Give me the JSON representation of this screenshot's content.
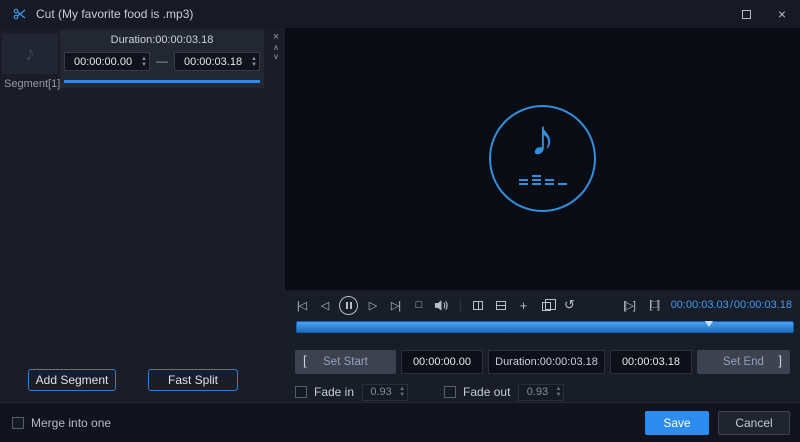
{
  "colors": {
    "accent": "#2d8cf0"
  },
  "titlebar": {
    "title": "Cut (My favorite food is .mp3)"
  },
  "segment_panel": {
    "duration": "Duration:00:00:03.18",
    "start": "00:00:00.00",
    "range_dash": "—",
    "end": "00:00:03.18",
    "segment_label": "Segment[1]",
    "add_segment": "Add Segment",
    "fast_split": "Fast Split"
  },
  "player": {
    "current_time": "00:00:03.03",
    "time_separator": "/",
    "total_time": "00:00:03.18",
    "playhead_percent": 83
  },
  "cut_bar": {
    "left_bracket": "[",
    "set_start": "Set Start",
    "start_time": "00:00:00.00",
    "duration": "Duration:00:00:03.18",
    "end_time": "00:00:03.18",
    "set_end": "Set End",
    "right_bracket": "]",
    "fade_in": "Fade in",
    "fade_in_seconds": "0.93",
    "fade_out": "Fade out",
    "fade_out_seconds": "0.93"
  },
  "footer": {
    "merge_into_one": "Merge into one",
    "save": "Save",
    "cancel": "Cancel"
  },
  "icons": {
    "close": "×",
    "chevron_up": "∧",
    "chevron_down": "∨",
    "spin_up": "▲",
    "spin_down": "▼",
    "music_note": "♪",
    "skip_start": "|◁",
    "prev_frame": "◁",
    "next_frame": "▷",
    "skip_end": "▷|",
    "stop": "□",
    "plus": "+",
    "reset": "↺",
    "play_clip": "[▷]",
    "stop_clip": "[□]"
  }
}
